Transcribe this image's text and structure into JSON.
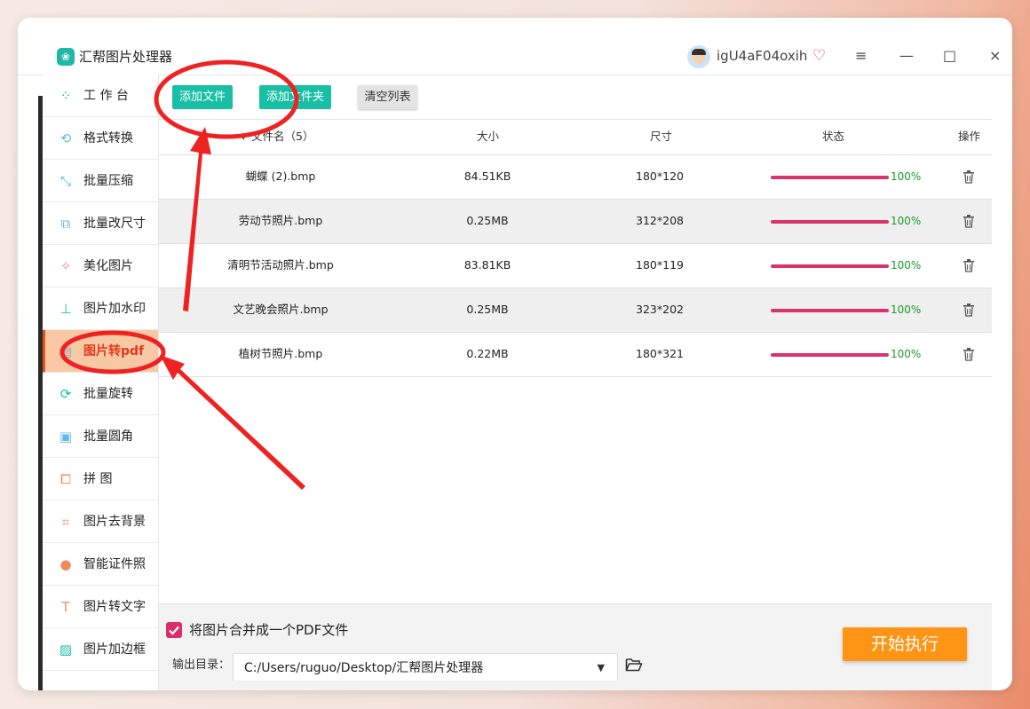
{
  "app": {
    "title": "汇帮图片处理器",
    "logo_icon": "image-leaf-icon",
    "username": "igU4aF04oxih",
    "brand_color": "#19bfa4"
  },
  "window_controls": {
    "menu": "≡",
    "minimize": "—",
    "maximize": "□",
    "close": "×"
  },
  "sidebar": {
    "items": [
      {
        "label": "工 作 台",
        "icon": "grid-icon"
      },
      {
        "label": "格式转换",
        "icon": "convert-icon"
      },
      {
        "label": "批量压缩",
        "icon": "compress-icon"
      },
      {
        "label": "批量改尺寸",
        "icon": "resize-icon"
      },
      {
        "label": "美化图片",
        "icon": "beautify-icon"
      },
      {
        "label": "图片加水印",
        "icon": "watermark-icon"
      },
      {
        "label": "图片转pdf",
        "icon": "pdf-icon",
        "active": true
      },
      {
        "label": "批量旋转",
        "icon": "rotate-icon"
      },
      {
        "label": "批量圆角",
        "icon": "rounded-corner-icon"
      },
      {
        "label": "拼   图",
        "icon": "collage-icon"
      },
      {
        "label": "图片去背景",
        "icon": "crop-icon"
      },
      {
        "label": "智能证件照",
        "icon": "person-icon"
      },
      {
        "label": "图片转文字",
        "icon": "text-icon"
      },
      {
        "label": "图片加边框",
        "icon": "frame-icon"
      }
    ]
  },
  "toolbar": {
    "add_file": "添加文件",
    "add_folder": "添加文件夹",
    "clear_list": "清空列表"
  },
  "table": {
    "headers": {
      "name": "文件名（5）",
      "size": "大小",
      "dimensions": "尺寸",
      "status": "状态",
      "action": "操作"
    },
    "rows": [
      {
        "name": "蝴蝶 (2).bmp",
        "size": "84.51KB",
        "dim": "180*120",
        "progress": 100,
        "pct": "100%"
      },
      {
        "name": "劳动节照片.bmp",
        "size": "0.25MB",
        "dim": "312*208",
        "progress": 100,
        "pct": "100%"
      },
      {
        "name": "清明节活动照片.bmp",
        "size": "83.81KB",
        "dim": "180*119",
        "progress": 100,
        "pct": "100%"
      },
      {
        "name": "文艺晚会照片.bmp",
        "size": "0.25MB",
        "dim": "323*202",
        "progress": 100,
        "pct": "100%"
      },
      {
        "name": "植树节照片.bmp",
        "size": "0.22MB",
        "dim": "180*321",
        "progress": 100,
        "pct": "100%"
      }
    ]
  },
  "bottom": {
    "merge_checkbox_label": "将图片合并成一个PDF文件",
    "merge_checked": true,
    "output_label": "输出目录：",
    "output_path": "C:/Users/ruguo/Desktop/汇帮图片处理器",
    "start_button": "开始执行"
  },
  "colors": {
    "progress_fill": "#d9336a",
    "progress_text": "#1a9a2a",
    "start_button": "#ff9415",
    "active_item_bg": "#f7c8a3",
    "annotation": "#ee2222"
  }
}
